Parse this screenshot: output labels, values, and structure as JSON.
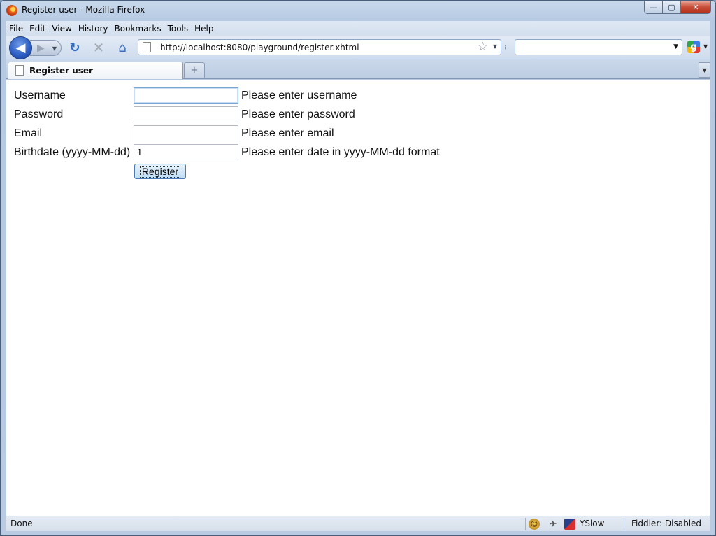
{
  "window": {
    "title": "Register user - Mozilla Firefox",
    "buttons": {
      "minimize": "—",
      "maximize": "▢",
      "close": "✕"
    }
  },
  "menubar": {
    "items": [
      "File",
      "Edit",
      "View",
      "History",
      "Bookmarks",
      "Tools",
      "Help"
    ]
  },
  "navbar": {
    "url": "http://localhost:8080/playground/register.xhtml",
    "search_value": "",
    "search_engine_icon": "google-icon",
    "icons": {
      "back": "◀",
      "forward": "▶",
      "reload": "↻",
      "stop": "✕",
      "home": "⌂",
      "bookmark_star": "☆"
    }
  },
  "tabs": {
    "items": [
      {
        "label": "Register user",
        "active": true
      }
    ],
    "new_tab_symbol": "+"
  },
  "form": {
    "fields": [
      {
        "label": "Username",
        "value": "",
        "message": "Please enter username",
        "focused": true
      },
      {
        "label": "Password",
        "value": "",
        "message": "Please enter password",
        "focused": false
      },
      {
        "label": "Email",
        "value": "",
        "message": "Please enter email",
        "focused": false
      },
      {
        "label": "Birthdate (yyyy-MM-dd)",
        "value": "1",
        "message": "Please enter date in yyyy-MM-dd format",
        "focused": false
      }
    ],
    "submit_label": "Register"
  },
  "statusbar": {
    "status": "Done",
    "yslow": "YSlow",
    "fiddler": "Fiddler: Disabled"
  }
}
